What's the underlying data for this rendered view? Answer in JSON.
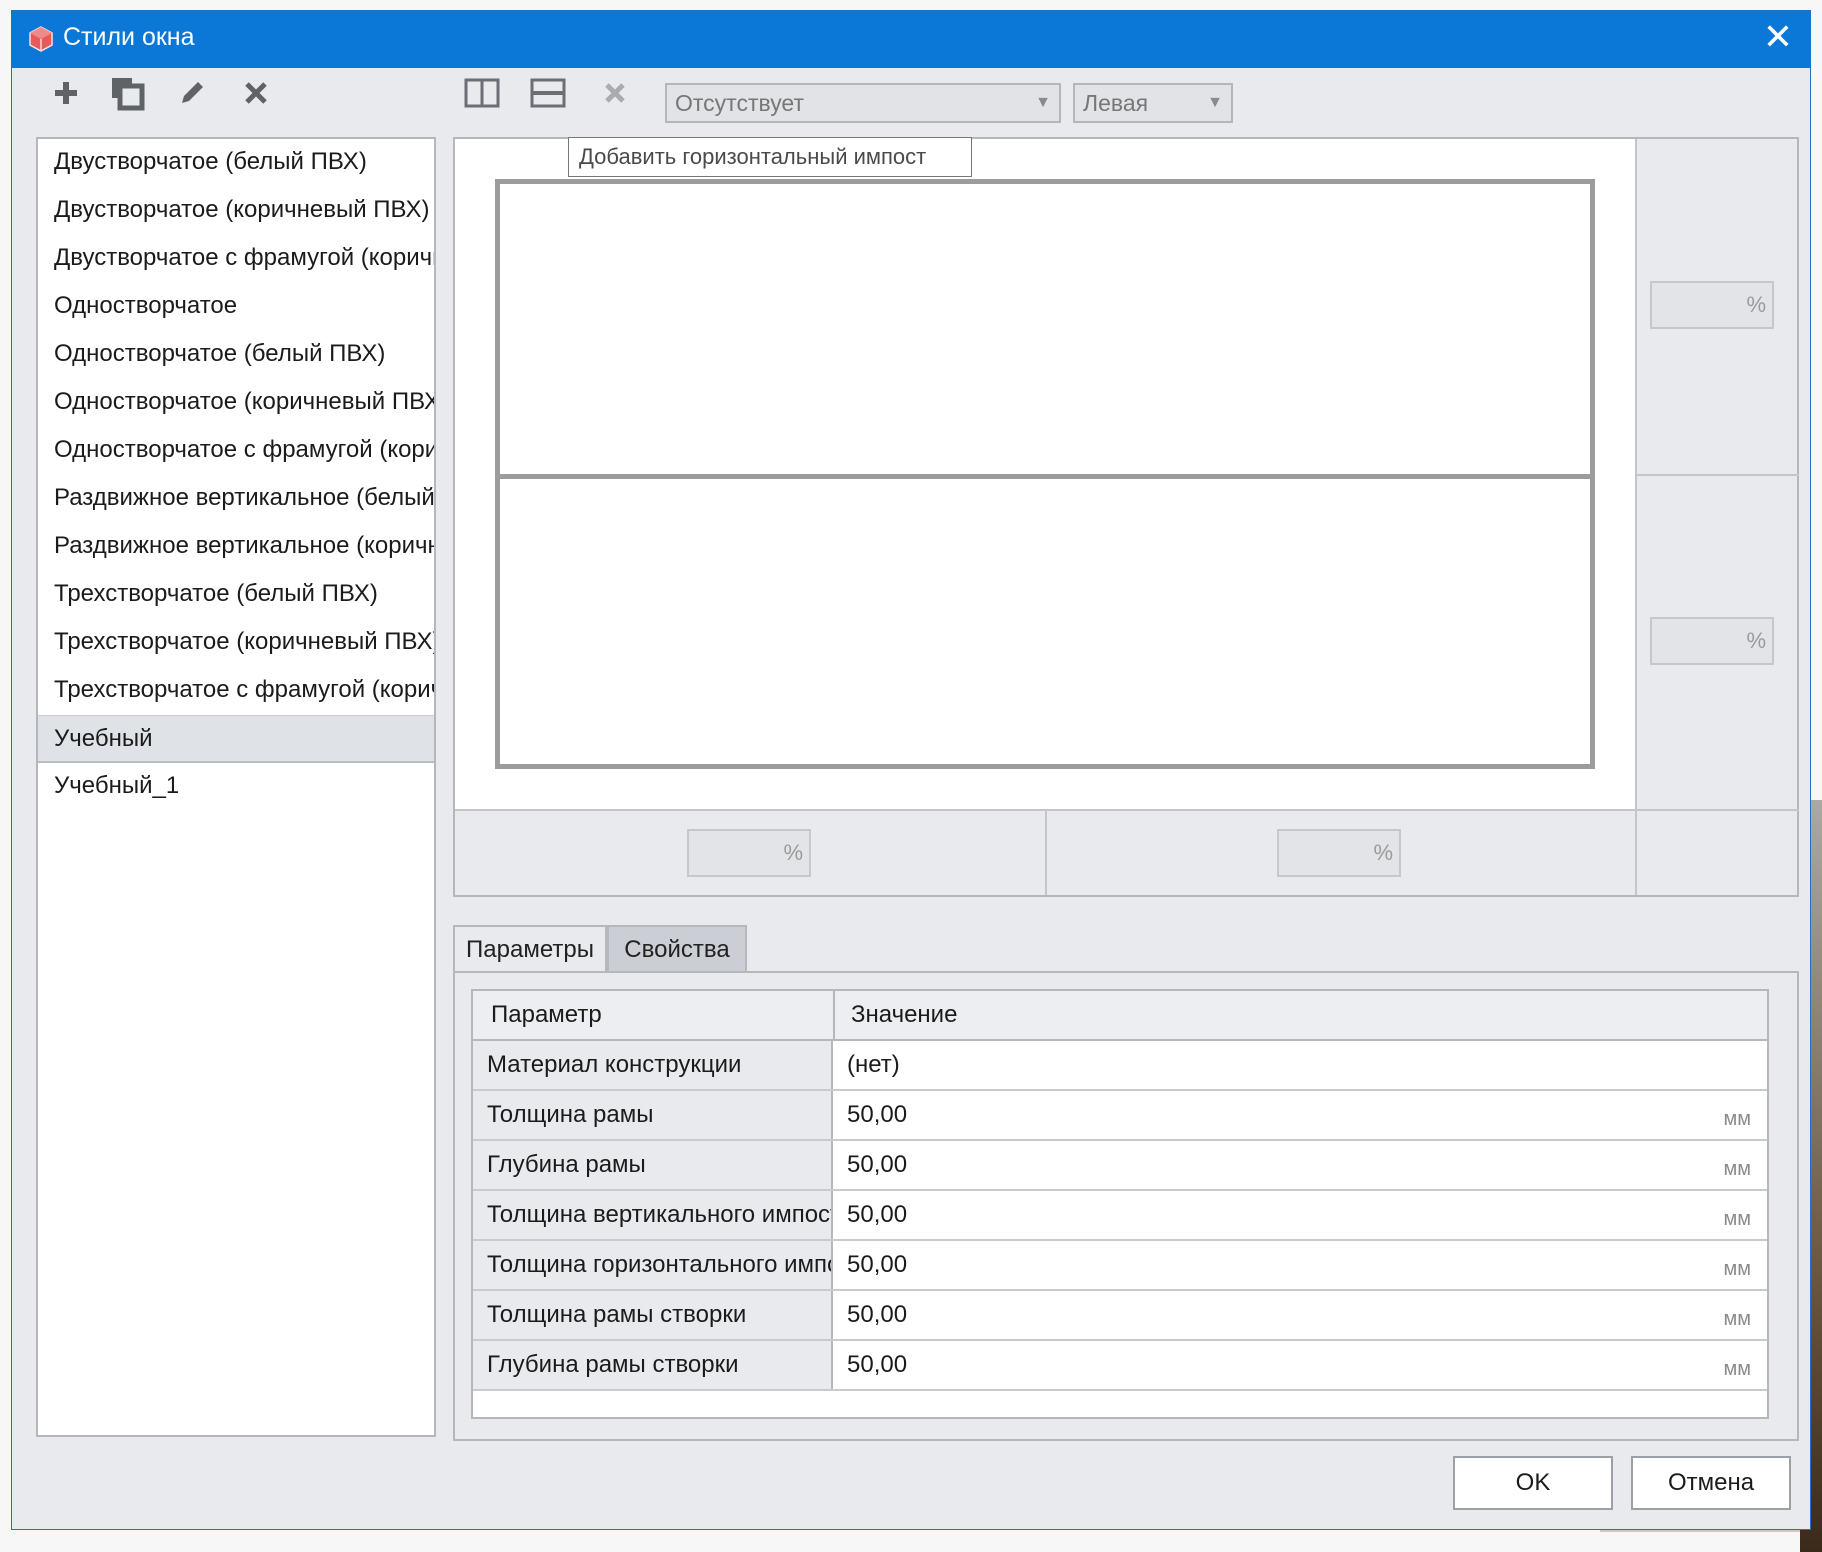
{
  "window": {
    "title": "Стили окна",
    "close_symbol": "✕"
  },
  "list": {
    "items": [
      {
        "label": "Двустворчатое (белый ПВХ)"
      },
      {
        "label": "Двустворчатое (коричневый ПВХ)"
      },
      {
        "label": "Двустворчатое с фрамугой (коричневый ПВХ)"
      },
      {
        "label": "Одностворчатое"
      },
      {
        "label": "Одностворчатое (белый ПВХ)"
      },
      {
        "label": "Одностворчатое (коричневый ПВХ)"
      },
      {
        "label": "Одностворчатое с фрамугой (коричневый ПВХ)"
      },
      {
        "label": "Раздвижное вертикальное (белый ПВХ)"
      },
      {
        "label": "Раздвижное вертикальное (коричневый ПВХ)"
      },
      {
        "label": "Трехстворчатое (белый ПВХ)"
      },
      {
        "label": "Трехстворчатое (коричневый ПВХ)"
      },
      {
        "label": "Трехстворчатое с фрамугой (коричневый ПВХ)"
      },
      {
        "label": "Учебный",
        "selected": true
      },
      {
        "label": "Учебный_1"
      }
    ]
  },
  "toolbar": {
    "icons": [
      "add-icon",
      "copy-icon",
      "edit-icon",
      "delete-icon",
      "vertical-mullion-icon",
      "horizontal-mullion-icon",
      "remove-mullion-icon"
    ],
    "opening_select": "Отсутствует",
    "side_select": "Левая",
    "tooltip": "Добавить горизонтальный импост"
  },
  "preview": {
    "percent_unit": "%",
    "colors": {
      "frame": "#9c9c9c",
      "accent": "#0b78d7"
    }
  },
  "tabs": [
    {
      "label": "Параметры",
      "active": true
    },
    {
      "label": "Свойства",
      "active": false
    }
  ],
  "grid": {
    "headers": {
      "param": "Параметр",
      "value": "Значение"
    },
    "rows": [
      {
        "name": "Материал конструкции",
        "value": "(нет)",
        "unit": ""
      },
      {
        "name": "Толщина рамы",
        "value": "50,00",
        "unit": "мм"
      },
      {
        "name": "Глубина рамы",
        "value": "50,00",
        "unit": "мм"
      },
      {
        "name": "Толщина вертикального импоста",
        "value": "50,00",
        "unit": "мм"
      },
      {
        "name": "Толщина горизонтального импоста",
        "value": "50,00",
        "unit": "мм"
      },
      {
        "name": "Толщина рамы створки",
        "value": "50,00",
        "unit": "мм"
      },
      {
        "name": "Глубина рамы створки",
        "value": "50,00",
        "unit": "мм"
      }
    ]
  },
  "buttons": {
    "ok": "OK",
    "cancel": "Отмена"
  }
}
